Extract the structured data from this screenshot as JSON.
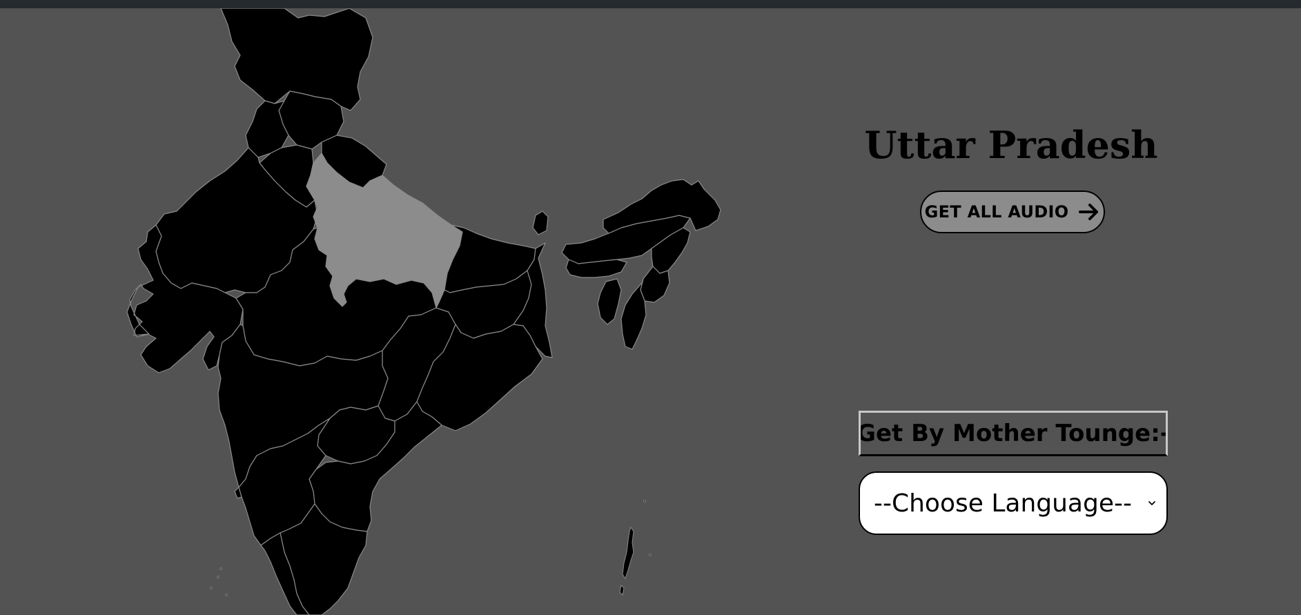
{
  "page": {
    "background": "#535353",
    "topbar_color": "#252a2f"
  },
  "map": {
    "highlighted_state": "Uttar Pradesh",
    "state_fill": "#000000",
    "highlight_fill": "#8c8c8c",
    "border_color": "#8a8a8a"
  },
  "header": {
    "title": "Uttar Pradesh"
  },
  "audio_button": {
    "label": "GET ALL AUDIO",
    "icon": "arrow-right-icon"
  },
  "language": {
    "label": "Get By Mother Tounge:-",
    "selected": "--Choose Language--",
    "icon": "chevron-down-icon"
  }
}
